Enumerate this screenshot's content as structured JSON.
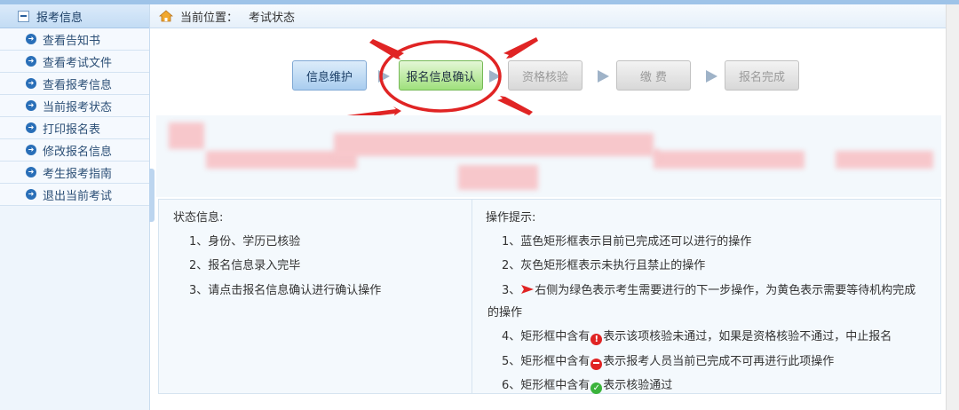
{
  "sidebar": {
    "header": "报考信息",
    "items": [
      {
        "label": "查看告知书"
      },
      {
        "label": "查看考试文件"
      },
      {
        "label": "查看报考信息"
      },
      {
        "label": "当前报考状态"
      },
      {
        "label": "打印报名表"
      },
      {
        "label": "修改报名信息"
      },
      {
        "label": "考生报考指南"
      },
      {
        "label": "退出当前考试"
      }
    ]
  },
  "breadcrumb": {
    "prefix": "当前位置：",
    "current": "考试状态"
  },
  "steps": [
    {
      "label": "信息维护",
      "state": "blue"
    },
    {
      "label": "报名信息确认",
      "state": "green"
    },
    {
      "label": "资格核验",
      "state": "gray"
    },
    {
      "label": "缴 费",
      "state": "gray"
    },
    {
      "label": "报名完成",
      "state": "gray"
    }
  ],
  "status": {
    "title": "状态信息:",
    "lines": [
      "1、身份、学历已核验",
      "2、报名信息录入完毕",
      "3、请点击报名信息确认进行确认操作"
    ]
  },
  "tips": {
    "title": "操作提示:",
    "line1": "1、蓝色矩形框表示目前已完成还可以进行的操作",
    "line2": "2、灰色矩形框表示未执行且禁止的操作",
    "line3a": "3、",
    "line3b": "右侧为绿色表示考生需要进行的下一步操作，为黄色表示需要等待机构完成",
    "line3c": "的操作",
    "line4a": "4、矩形框中含有",
    "line4b": "表示该项核验未通过，如果是资格核验不通过，中止报名",
    "line5a": "5、矩形框中含有",
    "line5b": "表示报考人员当前已完成不可再进行此项操作",
    "line6a": "6、矩形框中含有",
    "line6b": "表示核验通过"
  },
  "colors": {
    "annotation_red": "#e02424",
    "step_blue": "#a9cdef",
    "step_green": "#9fe07c",
    "step_gray": "#d8d8d8"
  }
}
